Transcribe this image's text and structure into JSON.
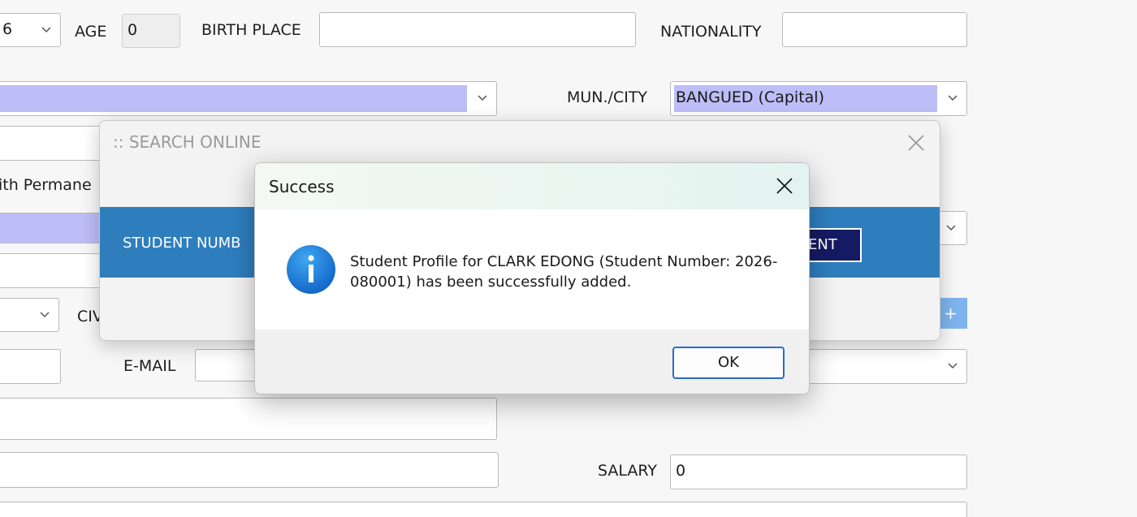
{
  "form": {
    "birth_month_value": "6",
    "age_label": "AGE",
    "age_value": "0",
    "birth_place_label": "BIRTH PLACE",
    "birth_place_value": "",
    "nationality_label": "NATIONALITY",
    "nationality_value": "",
    "mun_city_label": "MUN./CITY",
    "mun_city_value": "BANGUED (Capital)",
    "same_as_permanent_partial": "ith Permane",
    "civil_partial": "CIV",
    "email_label": "E-MAIL",
    "email_value": "",
    "salary_label": "SALARY",
    "salary_value": "0",
    "add_button_partial": "+"
  },
  "search_window": {
    "title": ":: SEARCH ONLINE",
    "student_number_label_partial": "STUDENT NUMB",
    "action_button_partial": "ENT"
  },
  "dialog": {
    "title": "Success",
    "message": "Student Profile for CLARK EDONG (Student Number: 2026-080001) has been successfully added.",
    "ok_label": "OK"
  },
  "colors": {
    "highlight": "#bdbdf7",
    "band_blue": "#2e7ebe",
    "dark_button": "#151b63",
    "info_blue": "#1a7fd6"
  }
}
